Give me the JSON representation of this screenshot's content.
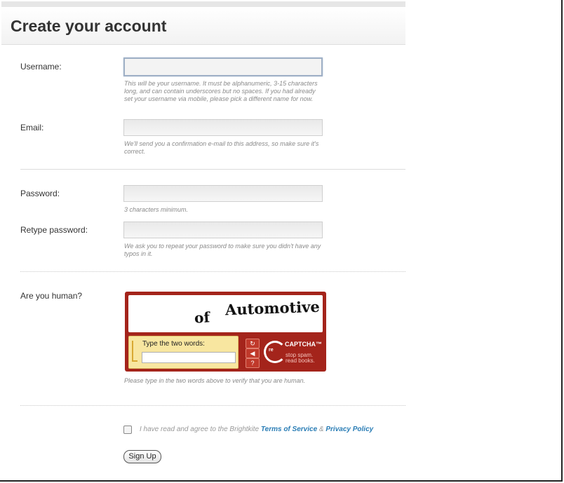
{
  "header": {
    "title": "Create your account"
  },
  "fields": {
    "username": {
      "label": "Username:",
      "value": "",
      "hint": "This will be your username. It must be alphanumeric, 3-15 characters long, and can contain underscores but no spaces. If you had already set your username via mobile, please pick a different name for now."
    },
    "email": {
      "label": "Email:",
      "value": "",
      "hint": "We'll send you a confirmation e-mail to this address, so make sure it's correct."
    },
    "password": {
      "label": "Password:",
      "value": "",
      "hint": "3 characters minimum."
    },
    "retype_password": {
      "label": "Retype password:",
      "value": "",
      "hint": "We ask you to repeat your password to make sure you didn't have any typos in it."
    }
  },
  "captcha": {
    "label": "Are you human?",
    "word_1": "of",
    "word_2": "Automotive",
    "prompt": "Type the two words:",
    "value": "",
    "brand_re": "re",
    "brand_name": "CAPTCHA™",
    "tagline_1": "stop spam.",
    "tagline_2": "read books.",
    "hint": "Please type in the two words above to verify that you are human.",
    "buttons": {
      "reload": "↻",
      "audio": "◀",
      "help": "?"
    },
    "colors": {
      "frame": "#a4241b",
      "answer_bg": "#f8e6a0"
    }
  },
  "terms": {
    "checked": false,
    "text": "I have read and agree to the Brightkite",
    "tos_link": "Terms of Service",
    "amp": "&",
    "privacy_link": "Privacy Policy"
  },
  "submit": {
    "label": "Sign Up"
  },
  "colors": {
    "link": "#2a7db5",
    "hint": "#8a8a8a"
  }
}
